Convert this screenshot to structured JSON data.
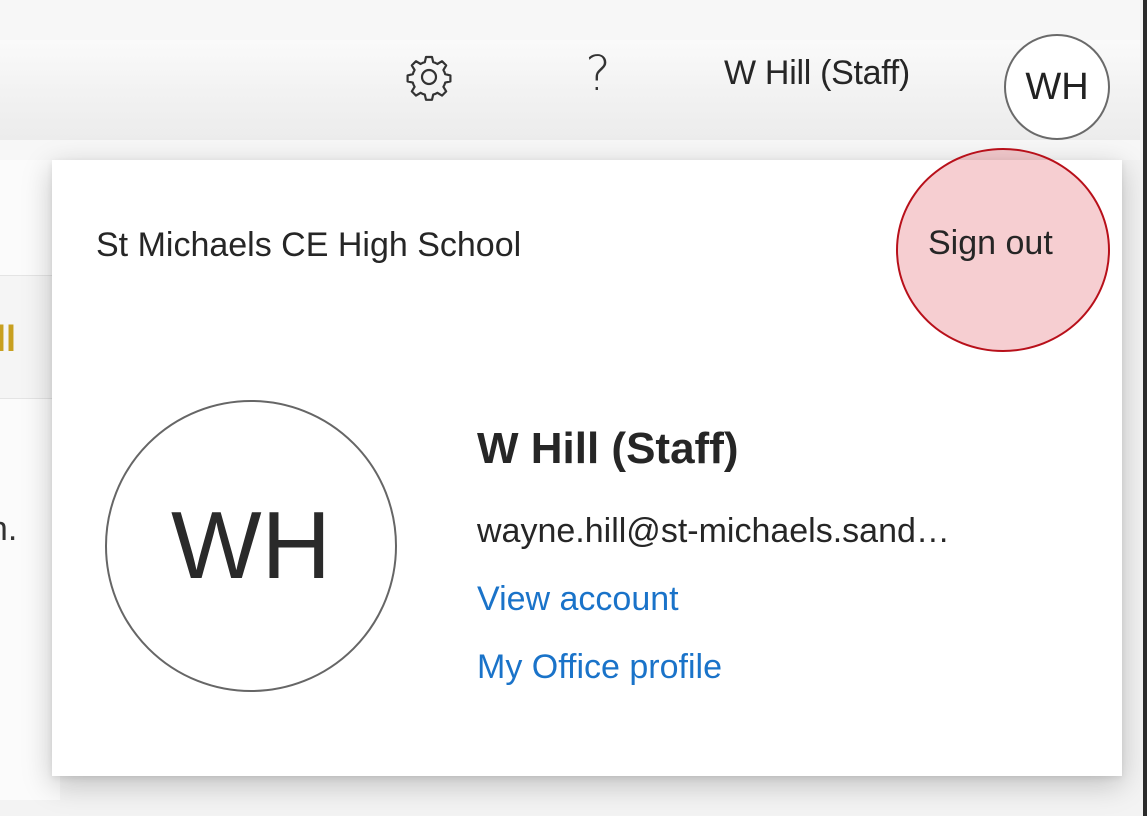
{
  "header": {
    "settings_icon": "gear-icon",
    "help_label": "?",
    "user_name": "W Hill (Staff)",
    "avatar_initials": "WH"
  },
  "background": {
    "partial_text_1": "All",
    "partial_text_2": "en."
  },
  "account_card": {
    "organization": "St Michaels CE High School",
    "sign_out_label": "Sign out",
    "avatar_initials": "WH",
    "display_name": "W Hill (Staff)",
    "email": "wayne.hill@st-michaels.sand…",
    "view_account_label": "View account",
    "office_profile_label": "My Office profile"
  },
  "colors": {
    "link": "#1a73c9",
    "highlight_fill": "#dc3c46",
    "highlight_stroke": "#b8101a",
    "background_accent_text": "#c8a020"
  }
}
